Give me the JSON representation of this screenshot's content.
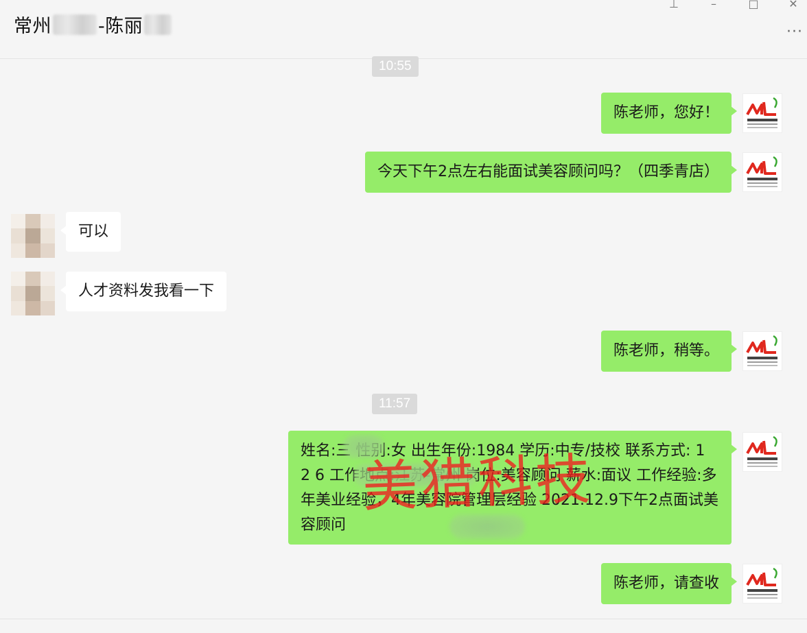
{
  "header": {
    "title_prefix": "常州",
    "title_middle": "-陈",
    "title_suffix": "丽"
  },
  "timestamps": [
    "10:55",
    "11:57"
  ],
  "messages": [
    {
      "side": "out",
      "text": "陈老师，您好！"
    },
    {
      "side": "out",
      "text": "今天下午2点左右能面试美容顾问吗？（四季青店）"
    },
    {
      "side": "in",
      "text": "可以"
    },
    {
      "side": "in",
      "text": "人才资料发我看一下"
    },
    {
      "side": "out",
      "text": "陈老师，稍等。"
    },
    {
      "side": "out",
      "text": "姓名:三 性别:女 出生年份:1984 学历:中专/技校 联系方式: 1 2 6 工作地点:江苏-常州 岗位:美容顾问 薪水:面议 工作经验:多年美业经验，4年美容院管理层经验 2021.12.9下午2点面试美容顾问"
    },
    {
      "side": "out",
      "text": "陈老师，请查收"
    }
  ],
  "avatar": {
    "logo_mark": "ML",
    "logo_text": "美猎客服3",
    "logo_url": "www.meilieuang.com"
  },
  "watermark": "美猎科技",
  "colors": {
    "outgoing_bubble": "#95ec69",
    "incoming_bubble": "#ffffff",
    "background": "#f5f5f5",
    "watermark": "#ee1e1e",
    "logo_red": "#e0281e",
    "logo_green": "#3aa832"
  }
}
